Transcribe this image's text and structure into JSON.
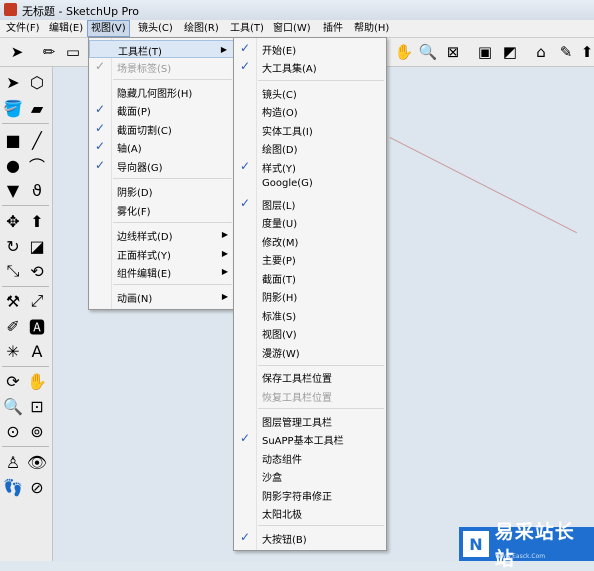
{
  "window": {
    "title": "无标题 - SketchUp Pro"
  },
  "menubar": {
    "items": [
      {
        "label": "文件(F)"
      },
      {
        "label": "编辑(E)"
      },
      {
        "label": "视图(V)"
      },
      {
        "label": "镜头(C)"
      },
      {
        "label": "绘图(R)"
      },
      {
        "label": "工具(T)"
      },
      {
        "label": "窗口(W)"
      },
      {
        "label": "插件"
      },
      {
        "label": "帮助(H)"
      }
    ]
  },
  "view_menu": {
    "items": [
      {
        "label": "工具栏(T)",
        "submenu": true
      },
      {
        "label": "场景标签(S)",
        "checked": true,
        "disabled": true
      },
      {
        "label": "隐藏几何图形(H)"
      },
      {
        "label": "截面(P)",
        "checked": true
      },
      {
        "label": "截面切割(C)",
        "checked": true
      },
      {
        "label": "轴(A)",
        "checked": true
      },
      {
        "label": "导向器(G)",
        "checked": true
      },
      {
        "label": "阴影(D)"
      },
      {
        "label": "雾化(F)"
      },
      {
        "label": "边线样式(D)",
        "submenu": true
      },
      {
        "label": "正面样式(Y)",
        "submenu": true
      },
      {
        "label": "组件编辑(E)",
        "submenu": true
      },
      {
        "label": "动画(N)",
        "submenu": true
      }
    ]
  },
  "toolbar_submenu": {
    "items": [
      {
        "label": "开始(E)",
        "checked": true
      },
      {
        "label": "大工具集(A)",
        "checked": true
      },
      {
        "label": "镜头(C)"
      },
      {
        "label": "构造(O)"
      },
      {
        "label": "实体工具(I)"
      },
      {
        "label": "绘图(D)"
      },
      {
        "label": "样式(Y)",
        "checked": true
      },
      {
        "label": "Google(G)"
      },
      {
        "label": "图层(L)",
        "checked": true
      },
      {
        "label": "度量(U)"
      },
      {
        "label": "修改(M)"
      },
      {
        "label": "主要(P)"
      },
      {
        "label": "截面(T)"
      },
      {
        "label": "阴影(H)"
      },
      {
        "label": "标准(S)"
      },
      {
        "label": "视图(V)"
      },
      {
        "label": "漫游(W)"
      },
      {
        "label": "保存工具栏位置"
      },
      {
        "label": "恢复工具栏位置",
        "disabled": true
      },
      {
        "label": "图层管理工具栏"
      },
      {
        "label": "SuAPP基本工具栏",
        "checked": true
      },
      {
        "label": "动态组件"
      },
      {
        "label": "沙盒"
      },
      {
        "label": "阴影字符串修正"
      },
      {
        "label": "太阳北极"
      },
      {
        "label": "大按钮(B)",
        "checked": true
      }
    ]
  },
  "check_glyph": "✓",
  "submenu_glyph": "▶",
  "watermark": {
    "text": "易采站长站",
    "sub": "Www.Easck.Com"
  }
}
